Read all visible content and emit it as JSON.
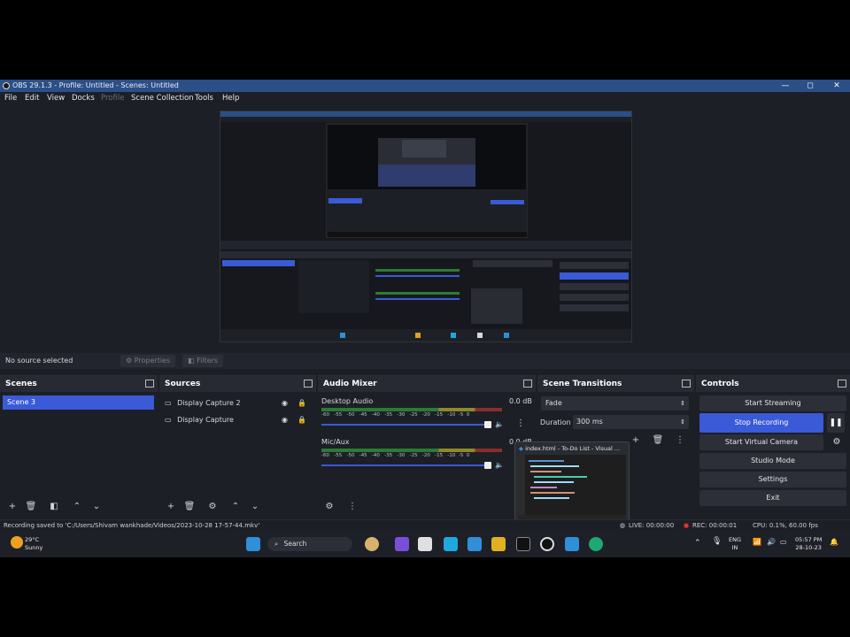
{
  "window": {
    "title": "OBS 29.1.3 - Profile: Untitled - Scenes: Untitled",
    "minimize": "—",
    "maximize": "◻",
    "close": "✕"
  },
  "menu": {
    "items": [
      "File",
      "Edit",
      "View",
      "Docks",
      "Profile",
      "Scene Collection",
      "Tools",
      "Help"
    ]
  },
  "properties_bar": {
    "no_source": "No source selected",
    "properties": "Properties",
    "filters": "Filters"
  },
  "scenes": {
    "title": "Scenes",
    "items": [
      "Scene 3"
    ]
  },
  "sources": {
    "title": "Sources",
    "items": [
      "Display Capture 2",
      "Display Capture"
    ]
  },
  "audio_mixer": {
    "title": "Audio Mixer",
    "channels": [
      {
        "name": "Desktop Audio",
        "level": "0.0 dB",
        "volume": 1.0
      },
      {
        "name": "Mic/Aux",
        "level": "0.0 dB",
        "volume": 1.0
      }
    ],
    "scale": [
      "-60",
      "-55",
      "-50",
      "-45",
      "-40",
      "-35",
      "-30",
      "-25",
      "-20",
      "-15",
      "-10",
      "-5",
      "0"
    ]
  },
  "transitions": {
    "title": "Scene Transitions",
    "selected": "Fade",
    "duration_label": "Duration",
    "duration_value": "300 ms"
  },
  "controls": {
    "title": "Controls",
    "start_streaming": "Start Streaming",
    "stop_recording": "Stop Recording",
    "start_virtual_camera": "Start Virtual Camera",
    "studio_mode": "Studio Mode",
    "settings": "Settings",
    "exit": "Exit"
  },
  "thumbnail": {
    "title": "index.html - To-Do List - Visual ..."
  },
  "status": {
    "saved": "Recording saved to 'C:/Users/Shivam wankhade/Videos/2023-10-28 17-57-44.mkv'",
    "live": "LIVE: 00:00:00",
    "rec": "REC: 00:00:01",
    "cpu": "CPU: 0.1%, 60.00 fps"
  },
  "taskbar": {
    "weather_temp": "29°C",
    "weather_desc": "Sunny",
    "search": "Search",
    "lang1": "ENG",
    "lang2": "IN",
    "time": "05:57 PM",
    "date": "28-10-23"
  },
  "colors": {
    "accent": "#3a5ad8",
    "titlebar": "#2b4f87",
    "background": "#1d1f26",
    "rec_red": "#e0312b"
  }
}
